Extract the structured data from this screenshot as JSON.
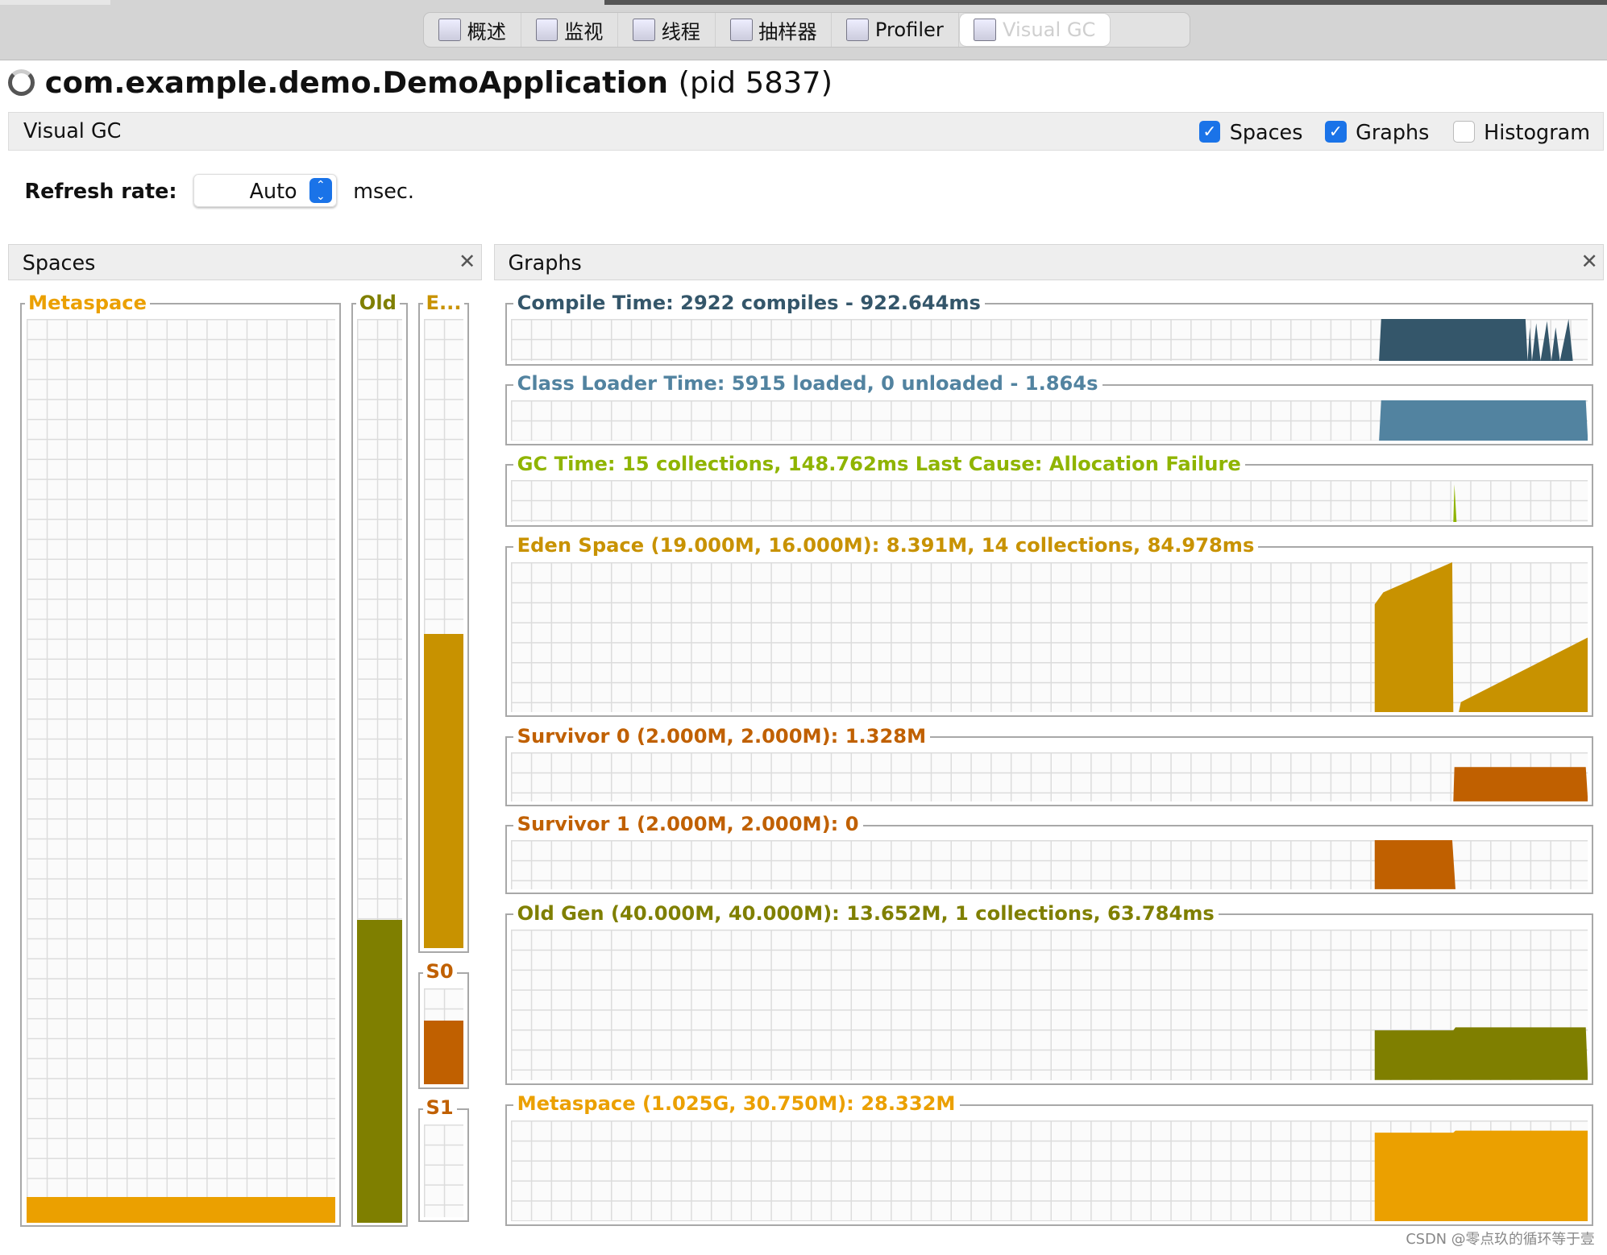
{
  "tabs": [
    {
      "label": "概述",
      "icon": "overview-icon"
    },
    {
      "label": "监视",
      "icon": "monitor-icon"
    },
    {
      "label": "线程",
      "icon": "threads-icon"
    },
    {
      "label": "抽样器",
      "icon": "sampler-icon"
    },
    {
      "label": "Profiler",
      "icon": "profiler-icon"
    },
    {
      "label": "Visual GC",
      "icon": "visualgc-icon",
      "active": true
    }
  ],
  "app": {
    "name": "com.example.demo.DemoApplication",
    "pid": "(pid 5837)"
  },
  "toolbar": {
    "title": "Visual GC",
    "spaces": "Spaces",
    "graphs": "Graphs",
    "histogram": "Histogram",
    "spaces_checked": true,
    "graphs_checked": true,
    "histogram_checked": false
  },
  "refresh": {
    "label": "Refresh rate:",
    "value": "Auto",
    "unit": "msec."
  },
  "spaces_panel": {
    "title": "Spaces",
    "metaspace": {
      "label": "Metaspace",
      "fill": 0.028,
      "color": "#eba000"
    },
    "old": {
      "label": "Old",
      "fill": 0.335,
      "color": "#7f7f00"
    },
    "eden": {
      "label": "E...",
      "fill": 0.5,
      "color": "#c89200"
    },
    "s0": {
      "label": "S0",
      "fill": 0.66,
      "color": "#c06000"
    },
    "s1": {
      "label": "S1",
      "fill": 0,
      "color": "#c06000"
    }
  },
  "graphs_panel": {
    "title": "Graphs",
    "graphs": [
      {
        "label": "Compile Time: 2922 compiles - 922.644ms",
        "color": "#34566a"
      },
      {
        "label": "Class Loader Time: 5915 loaded, 0 unloaded - 1.864s",
        "color": "#5283a0"
      },
      {
        "label": "GC Time: 15 collections, 148.762ms Last Cause: Allocation Failure",
        "color": "#8fb400"
      },
      {
        "label": "Eden Space (19.000M, 16.000M): 8.391M, 14 collections, 84.978ms",
        "color": "#c89200"
      },
      {
        "label": "Survivor 0 (2.000M, 2.000M): 1.328M",
        "color": "#c06000"
      },
      {
        "label": "Survivor 1 (2.000M, 2.000M): 0",
        "color": "#c06000"
      },
      {
        "label": "Old Gen (40.000M, 40.000M): 13.652M, 1 collections, 63.784ms",
        "color": "#7f7f00"
      },
      {
        "label": "Metaspace (1.025G, 30.750M): 28.332M",
        "color": "#eba000"
      }
    ]
  },
  "watermark": "CSDN @零点玖的循环等于壹"
}
